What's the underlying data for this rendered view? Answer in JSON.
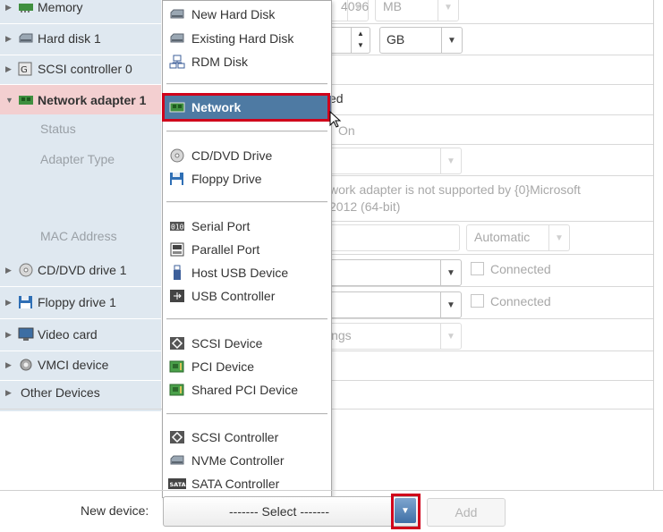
{
  "devices": [
    {
      "label": "Memory",
      "icon": "memory-icon",
      "expanded": false
    },
    {
      "label": "Hard disk 1",
      "icon": "hard-disk-icon",
      "expanded": false
    },
    {
      "label": "SCSI controller 0",
      "icon": "scsi-controller-icon",
      "expanded": false
    },
    {
      "label": "Network adapter 1",
      "icon": "network-adapter-icon",
      "expanded": true
    },
    {
      "label": "CD/DVD drive 1",
      "icon": "cd-dvd-icon",
      "expanded": false
    },
    {
      "label": "Floppy drive 1",
      "icon": "floppy-icon",
      "expanded": false
    },
    {
      "label": "Video card",
      "icon": "video-card-icon",
      "expanded": false
    },
    {
      "label": "VMCI device",
      "icon": "vmci-icon",
      "expanded": false
    },
    {
      "label": "Other Devices",
      "icon": "",
      "expanded": false
    }
  ],
  "network_sublabels": {
    "status": "Status",
    "adapter_type": "Adapter Type",
    "mac_address": "MAC Address"
  },
  "fields": {
    "memory_unit": "MB",
    "memory_value_partial": "4096",
    "hard_disk_unit": "GB",
    "connected_partial": "ed",
    "power_on_partial": "On",
    "adapter_warning_line1": "work adapter is not supported by {0}Microsoft",
    "adapter_warning_line2": "2012 (64-bit)",
    "mac_mode": "Automatic",
    "cd_connected": "Connected",
    "floppy_connected": "Connected",
    "video_partial": "ings"
  },
  "menu": {
    "groups": [
      [
        {
          "label": "New Hard Disk",
          "icon": "hard-disk-icon"
        },
        {
          "label": "Existing Hard Disk",
          "icon": "hard-disk-icon"
        },
        {
          "label": "RDM Disk",
          "icon": "rdm-disk-icon"
        }
      ],
      [
        {
          "label": "Network",
          "icon": "network-adapter-icon",
          "highlighted": true
        }
      ],
      [
        {
          "label": "CD/DVD Drive",
          "icon": "cd-dvd-icon"
        },
        {
          "label": "Floppy Drive",
          "icon": "floppy-icon"
        }
      ],
      [
        {
          "label": "Serial Port",
          "icon": "serial-port-icon"
        },
        {
          "label": "Parallel Port",
          "icon": "parallel-port-icon"
        },
        {
          "label": "Host USB Device",
          "icon": "usb-device-icon"
        },
        {
          "label": "USB Controller",
          "icon": "usb-controller-icon"
        }
      ],
      [
        {
          "label": "SCSI Device",
          "icon": "scsi-device-icon"
        },
        {
          "label": "PCI Device",
          "icon": "pci-device-icon"
        },
        {
          "label": "Shared PCI Device",
          "icon": "pci-device-icon"
        }
      ],
      [
        {
          "label": "SCSI Controller",
          "icon": "scsi-controller-icon"
        },
        {
          "label": "NVMe Controller",
          "icon": "nvme-controller-icon"
        },
        {
          "label": "SATA Controller",
          "icon": "sata-controller-icon"
        }
      ]
    ]
  },
  "bottom": {
    "new_device_label": "New device:",
    "select_text": "------- Select -------",
    "add_label": "Add"
  },
  "colors": {
    "highlight": "#4e7aa3",
    "annotation_red": "#d0021b",
    "selected_row": "#f3cfd0",
    "left_column": "#dfe8f0"
  }
}
